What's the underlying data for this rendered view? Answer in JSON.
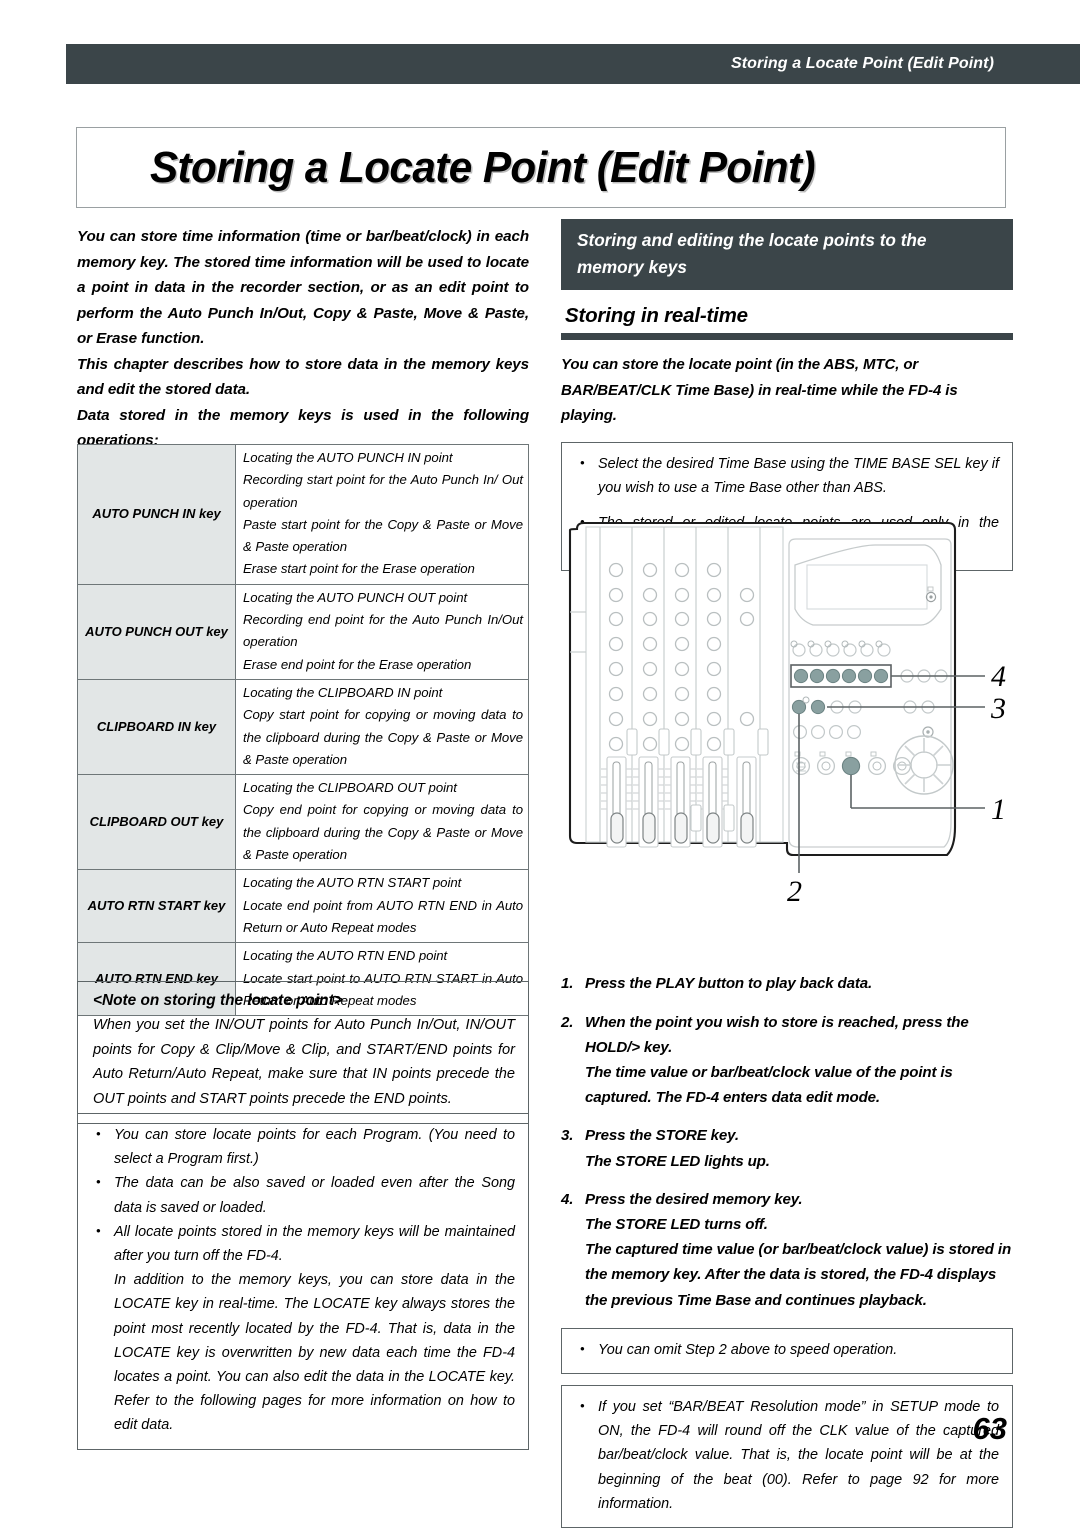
{
  "running_header": "Storing a Locate Point (Edit Point)",
  "page_title": "Storing a Locate Point (Edit Point)",
  "page_number": "63",
  "colors": {
    "header_bar": "#3b4549",
    "table_header_cell": "#e2e6e6",
    "rule": "#5d6567"
  },
  "left_column": {
    "intro_paragraphs": [
      "You can store time information (time or bar/beat/clock) in each memory key. The stored time information will be used to locate a point in data in the recorder section, or as an edit point to perform the Auto Punch In/Out, Copy & Paste, Move & Paste, or Erase function.",
      "This chapter describes how to store data in the memory keys and edit the stored data.",
      "Data stored in the memory keys is used in the following operations:"
    ],
    "key_table": {
      "rows": [
        {
          "key": "AUTO PUNCH IN key",
          "descriptions": [
            "Locating the AUTO PUNCH IN point",
            "Recording start point for the Auto Punch In/ Out operation",
            "Paste start point for the Copy & Paste or Move & Paste operation",
            "Erase start point for the Erase operation"
          ]
        },
        {
          "key": "AUTO PUNCH OUT key",
          "descriptions": [
            "Locating the AUTO PUNCH OUT point",
            "Recording end point for the Auto Punch In/Out operation",
            "Erase end point for the Erase operation"
          ]
        },
        {
          "key": "CLIPBOARD IN key",
          "descriptions": [
            "Locating the CLIPBOARD IN point",
            "Copy start point for copying or moving data to the clipboard during the Copy & Paste or Move & Paste operation"
          ]
        },
        {
          "key": "CLIPBOARD OUT key",
          "descriptions": [
            "Locating the CLIPBOARD OUT point",
            "Copy end point for copying or moving data to the clipboard during the Copy & Paste or Move & Paste operation"
          ]
        },
        {
          "key": "AUTO RTN START key",
          "descriptions": [
            "Locating the AUTO RTN START point",
            "Locate end point from AUTO RTN END in Auto Return or Auto Repeat modes"
          ]
        },
        {
          "key": "AUTO RTN END key",
          "descriptions": [
            "Locating the AUTO RTN END point",
            "Locate start point to AUTO RTN START in Auto Return or Auto Repeat modes"
          ]
        }
      ]
    },
    "note": {
      "title": "<Note on storing the locate point>",
      "body": "When you set the IN/OUT points for Auto Punch In/Out, IN/OUT points for Copy & Clip/Move & Clip, and START/END points for Auto Return/Auto Repeat, make sure that IN points precede the OUT points and START points precede the END points."
    },
    "bullets": [
      "You can store locate points for each Program. (You need to select a Program first.)",
      "The data can be also saved or loaded even after the Song data is saved or loaded.",
      "All locate points stored in the memory keys will be maintained after you turn off the FD-4."
    ],
    "bullet_continuation": "In addition to the memory keys, you can store data in the LOCATE key in real-time. The LOCATE key always stores the point most recently located by the FD-4. That is, data in the LOCATE key is overwritten by new data each time the FD-4 locates a point.  You can also edit the data in the LOCATE key. Refer to the following pages for more information on how to edit data."
  },
  "right_column": {
    "section_title": "Storing and editing the locate points to the memory keys",
    "sub_heading": "Storing in real-time",
    "intro": "You can store the locate point (in the ABS, MTC, or BAR/BEAT/CLK Time Base) in real-time while the FD-4 is playing.",
    "tips_top": [
      "Select the desired Time Base using the TIME BASE SEL key if you wish to use a Time Base other than ABS.",
      "The stored or edited locate points are used only in the currently-selected Program."
    ],
    "figure": {
      "callouts": [
        "4",
        "3",
        "1",
        "2"
      ]
    },
    "steps": [
      {
        "num": "1.",
        "text": "Press the PLAY button to play back data.",
        "sub": []
      },
      {
        "num": "2.",
        "text": "When the point you wish to store is reached, press the HOLD/> key.",
        "sub": [
          "The time value or bar/beat/clock value of the point is captured.  The FD-4 enters data edit mode."
        ]
      },
      {
        "num": "3.",
        "text": "Press the STORE key.",
        "sub": [
          "The STORE LED lights up."
        ]
      },
      {
        "num": "4.",
        "text": "Press the desired memory key.",
        "sub": [
          "The STORE LED turns off.",
          "The captured time value (or bar/beat/clock value) is stored in the memory key.  After the data is stored, the FD-4 displays the previous Time Base and continues playback."
        ]
      }
    ],
    "tip_omit": "You can omit Step 2 above to speed operation.",
    "tip_resolution": "If you set “BAR/BEAT Resolution mode” in SETUP mode to ON, the FD-4 will round off the CLK value of the captured bar/beat/clock value. That is, the locate point will be at the beginning of the beat (00).  Refer to page 92 for more information."
  }
}
